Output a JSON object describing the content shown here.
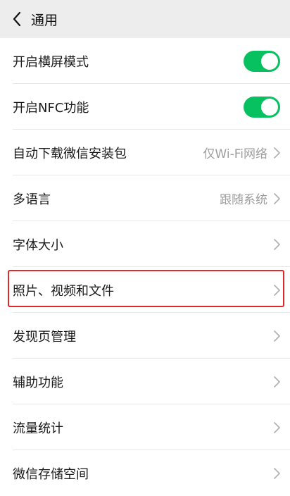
{
  "header": {
    "back_icon": "chevron-left-icon",
    "title": "通用"
  },
  "settings": [
    {
      "label": "开启横屏模式",
      "control": "toggle",
      "on": true
    },
    {
      "label": "开启NFC功能",
      "control": "toggle",
      "on": true
    },
    {
      "label": "自动下载微信安装包",
      "value": "仅Wi-Fi网络",
      "control": "chevron"
    },
    {
      "label": "多语言",
      "value": "跟随系统",
      "control": "chevron"
    },
    {
      "label": "字体大小",
      "control": "chevron"
    },
    {
      "label": "照片、视频和文件",
      "control": "chevron",
      "highlighted": true
    },
    {
      "label": "发现页管理",
      "control": "chevron"
    },
    {
      "label": "辅助功能",
      "control": "chevron"
    },
    {
      "label": "流量统计",
      "control": "chevron"
    },
    {
      "label": "微信存储空间",
      "control": "chevron"
    }
  ],
  "colors": {
    "toggle_on": "#07c160",
    "highlight_border": "#e02a2a",
    "header_bg": "#ededed",
    "secondary_text": "#9e9e9e"
  }
}
